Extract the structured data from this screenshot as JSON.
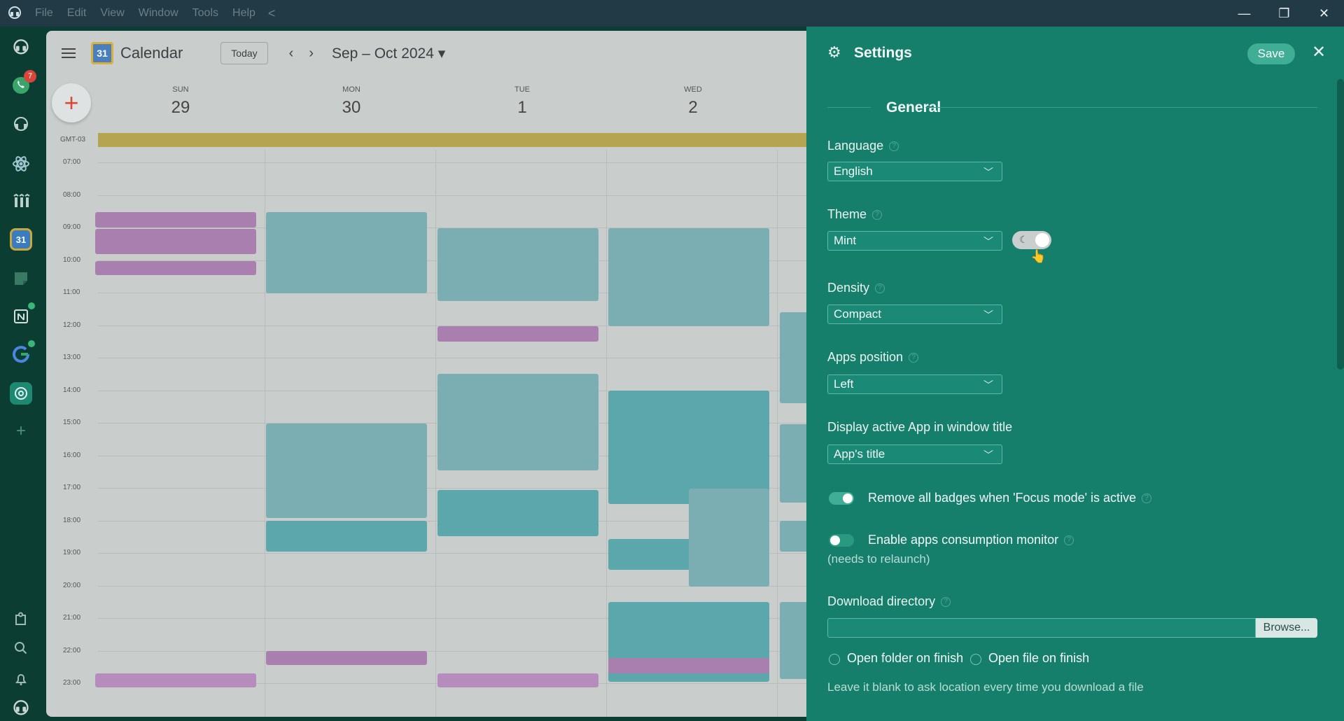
{
  "titlebar": {
    "menu": [
      "File",
      "Edit",
      "View",
      "Window",
      "Tools",
      "Help"
    ],
    "back_glyph": "<",
    "minimize": "—",
    "maximize": "❐",
    "close": "✕"
  },
  "appbar": {
    "whatsapp_badge": "7",
    "apps": [
      "franz-icon",
      "whatsapp-icon",
      "support-icon",
      "atom-icon",
      "kanban-icon",
      "calendar-icon",
      "notes-icon",
      "notion-icon",
      "google-icon",
      "chatgpt-icon",
      "add-icon"
    ],
    "bottom": [
      "puzzle-icon",
      "search-icon",
      "bell-icon",
      "profile-icon"
    ]
  },
  "calendar": {
    "title": "Calendar",
    "logo_text": "31",
    "today": "Today",
    "range": "Sep – Oct 2024 ▾",
    "timezone": "GMT-03",
    "days": [
      {
        "dow": "SUN",
        "num": "29"
      },
      {
        "dow": "MON",
        "num": "30"
      },
      {
        "dow": "TUE",
        "num": "1"
      },
      {
        "dow": "WED",
        "num": "2"
      }
    ],
    "hours": [
      "07:00",
      "08:00",
      "09:00",
      "10:00",
      "11:00",
      "12:00",
      "13:00",
      "14:00",
      "15:00",
      "16:00",
      "17:00",
      "18:00",
      "19:00",
      "20:00",
      "21:00",
      "22:00",
      "23:00"
    ]
  },
  "settings": {
    "title": "Settings",
    "save": "Save",
    "close": "✕",
    "section": "General",
    "language": {
      "label": "Language",
      "value": "English"
    },
    "theme": {
      "label": "Theme",
      "value": "Mint"
    },
    "density": {
      "label": "Density",
      "value": "Compact"
    },
    "apps_position": {
      "label": "Apps position",
      "value": "Left"
    },
    "active_app_title": {
      "label": "Display active App in window title",
      "value": "App's title"
    },
    "remove_badges": {
      "label": "Remove all badges when 'Focus mode' is active",
      "on": true
    },
    "consumption": {
      "label": "Enable apps consumption monitor",
      "note": "(needs to relaunch)",
      "on": false
    },
    "download": {
      "label": "Download directory",
      "browse": "Browse...",
      "open_folder": "Open folder on finish",
      "open_file": "Open file on finish",
      "hint": "Leave it blank to ask location every time you download a file"
    }
  }
}
